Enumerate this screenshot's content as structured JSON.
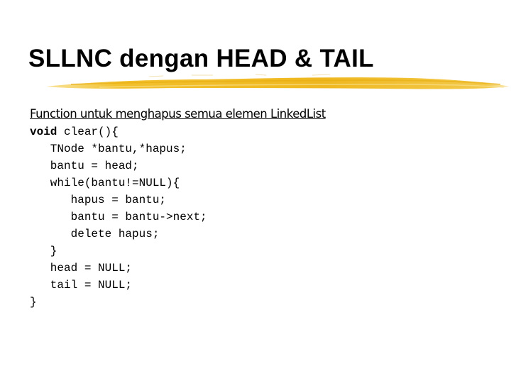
{
  "slide": {
    "title": "SLLNC dengan HEAD & TAIL",
    "accent_color": "#F2C12E",
    "heading": "Function untuk menghapus semua elemen LinkedList",
    "code": {
      "signature_keyword": "void",
      "signature_rest": " clear(){",
      "lines": [
        "   TNode *bantu,*hapus;",
        "   bantu = head;",
        "   while(bantu!=NULL){",
        "      hapus = bantu;",
        "      bantu = bantu->next;",
        "      delete hapus;",
        "   }",
        "   head = NULL;",
        "   tail = NULL;",
        "}"
      ]
    }
  }
}
